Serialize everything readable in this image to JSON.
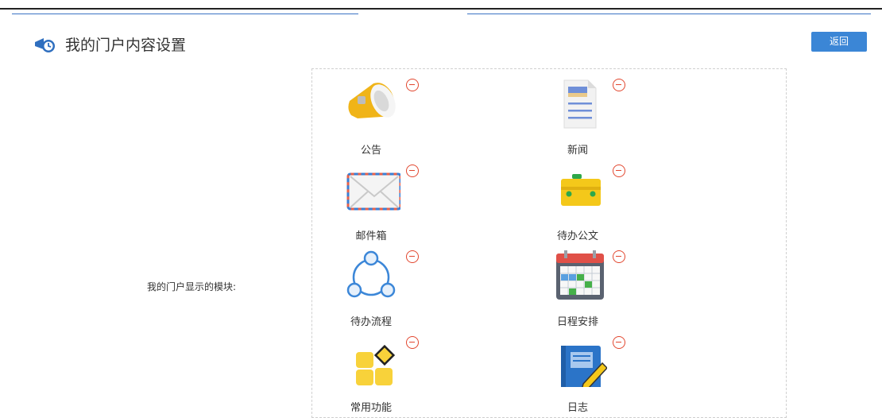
{
  "header": {
    "title": "我的门户内容设置",
    "back_label": "返回",
    "icon": "megaphone-portal-icon"
  },
  "form": {
    "modules_label": "我的门户显示的模块:"
  },
  "modules": [
    {
      "label": "公告",
      "icon": "announcement-icon"
    },
    {
      "label": "新闻",
      "icon": "news-icon"
    },
    {
      "label": "邮件箱",
      "icon": "mailbox-icon"
    },
    {
      "label": "待办公文",
      "icon": "document-briefcase-icon"
    },
    {
      "label": "待办流程",
      "icon": "workflow-icon"
    },
    {
      "label": "日程安排",
      "icon": "calendar-icon"
    },
    {
      "label": "常用功能",
      "icon": "common-functions-icon"
    },
    {
      "label": "日志",
      "icon": "journal-icon"
    }
  ],
  "colors": {
    "accent": "#3b86d6",
    "remove": "#e2472f"
  }
}
